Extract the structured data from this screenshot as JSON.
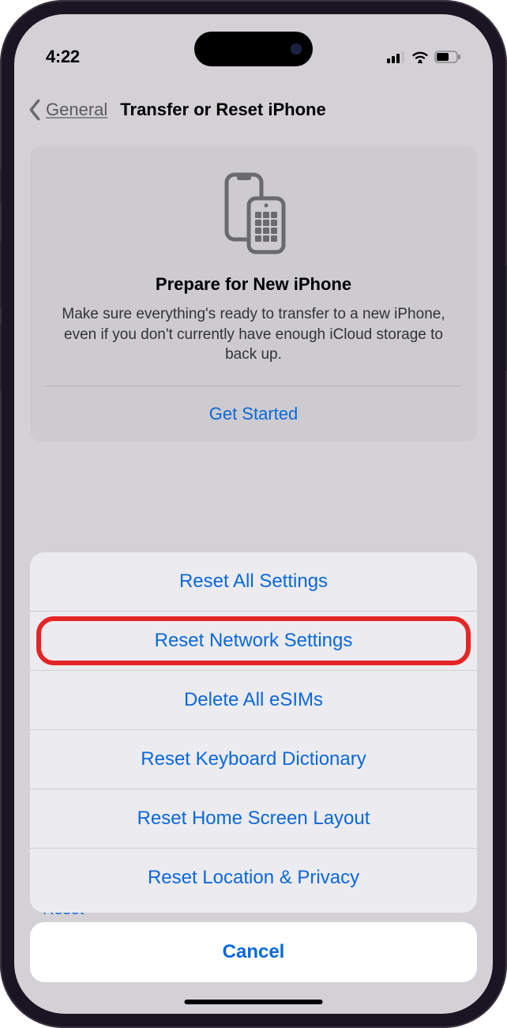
{
  "statusBar": {
    "time": "4:22"
  },
  "nav": {
    "back_label": "General",
    "title": "Transfer or Reset iPhone"
  },
  "prepare_card": {
    "title": "Prepare for New iPhone",
    "description": "Make sure everything's ready to transfer to a new iPhone, even if you don't currently have enough iCloud storage to back up.",
    "action_label": "Get Started"
  },
  "sheet": {
    "items": [
      {
        "label": "Reset All Settings"
      },
      {
        "label": "Reset Network Settings"
      },
      {
        "label": "Delete All eSIMs"
      },
      {
        "label": "Reset Keyboard Dictionary"
      },
      {
        "label": "Reset Home Screen Layout"
      },
      {
        "label": "Reset Location & Privacy"
      }
    ],
    "cancel_label": "Cancel"
  },
  "bg_hint": "Reset"
}
